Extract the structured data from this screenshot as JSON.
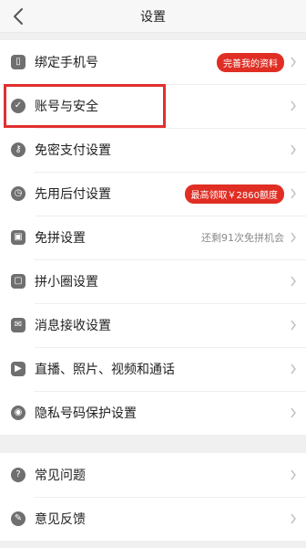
{
  "header": {
    "title": "设置"
  },
  "group1": {
    "items": [
      {
        "label": "绑定手机号",
        "badge": "完善我的资料"
      },
      {
        "label": "账号与安全"
      },
      {
        "label": "免密支付设置"
      },
      {
        "label": "先用后付设置",
        "badge": "最高领取￥2860额度"
      },
      {
        "label": "免拼设置",
        "hint": "还剩91次免拼机会"
      },
      {
        "label": "拼小圈设置"
      },
      {
        "label": "消息接收设置"
      },
      {
        "label": "直播、照片、视频和通话"
      },
      {
        "label": "隐私号码保护设置"
      }
    ]
  },
  "group2": {
    "items": [
      {
        "label": "常见问题"
      },
      {
        "label": "意见反馈"
      }
    ]
  },
  "colors": {
    "accent": "#e02e24",
    "highlight": "#e0302f"
  }
}
